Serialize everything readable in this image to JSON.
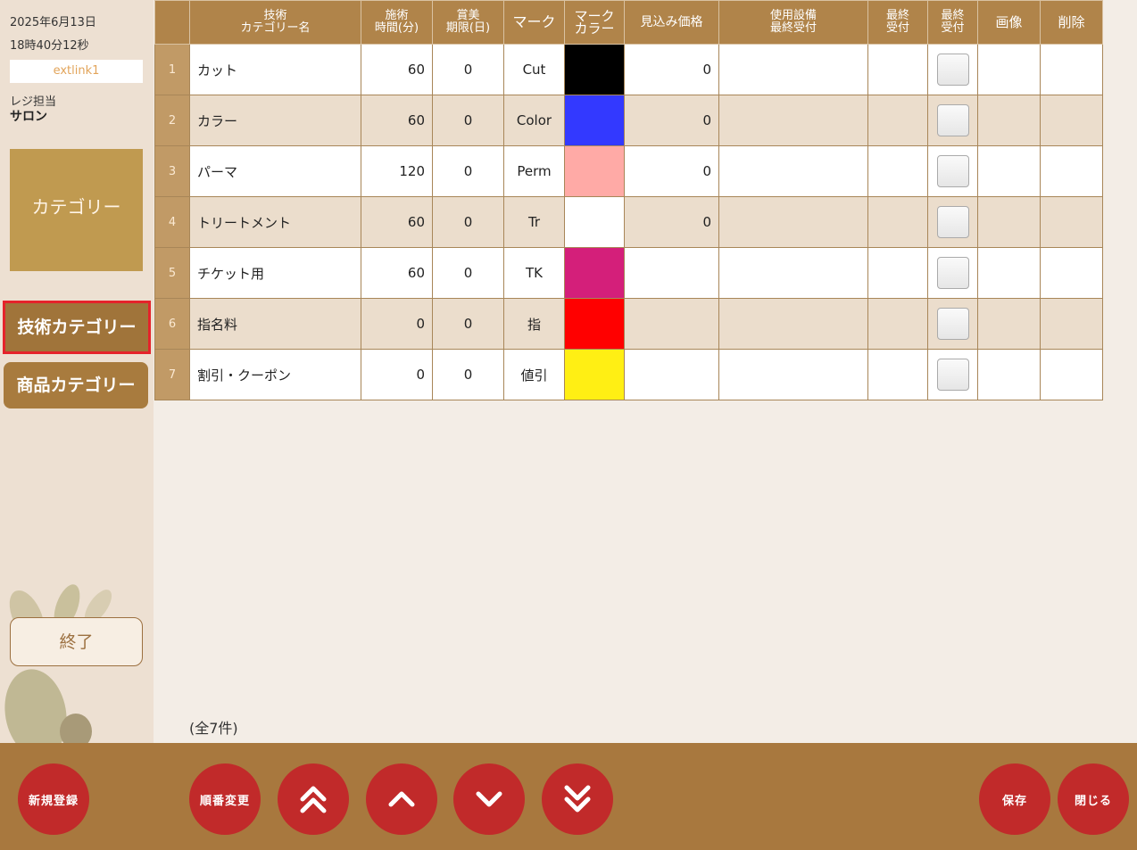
{
  "sidebar": {
    "date": "2025年6月13日",
    "time": "18時40分12秒",
    "link": "extlink1",
    "register_label": "レジ担当",
    "salon": "サロン",
    "category_main": "カテゴリー",
    "tech_category": "技術カテゴリー",
    "product_category": "商品カテゴリー",
    "exit": "終了"
  },
  "table": {
    "headers": {
      "name_1": "技術",
      "name_2": "カテゴリー名",
      "time_1": "施術",
      "time_2": "時間(分)",
      "expiry_1": "賞美",
      "expiry_2": "期限(日)",
      "mark": "マーク",
      "markcolor_1": "マーク",
      "markcolor_2": "カラー",
      "price": "見込み価格",
      "equip_1": "使用設備",
      "equip_2": "最終受付",
      "last1_1": "最終",
      "last1_2": "受付",
      "last2_1": "最終",
      "last2_2": "受付",
      "image": "画像",
      "delete": "削除"
    },
    "rows": [
      {
        "no": "1",
        "name": "カット",
        "time": "60",
        "expiry": "0",
        "mark": "Cut",
        "color": "#000000",
        "price": "0"
      },
      {
        "no": "2",
        "name": "カラー",
        "time": "60",
        "expiry": "0",
        "mark": "Color",
        "color": "#3339ff",
        "price": "0"
      },
      {
        "no": "3",
        "name": "パーマ",
        "time": "120",
        "expiry": "0",
        "mark": "Perm",
        "color": "#ffaaa6",
        "price": "0"
      },
      {
        "no": "4",
        "name": "トリートメント",
        "time": "60",
        "expiry": "0",
        "mark": "Tr",
        "color": "#ffffff",
        "price": "0"
      },
      {
        "no": "5",
        "name": "チケット用",
        "time": "60",
        "expiry": "0",
        "mark": "TK",
        "color": "#d41f7a",
        "price": ""
      },
      {
        "no": "6",
        "name": "指名料",
        "time": "0",
        "expiry": "0",
        "mark": "指",
        "color": "#ff0000",
        "price": ""
      },
      {
        "no": "7",
        "name": "割引・クーポン",
        "time": "0",
        "expiry": "0",
        "mark": "値引",
        "color": "#ffef14",
        "price": ""
      }
    ]
  },
  "count": "(全7件)",
  "footer": {
    "new": "新規登録",
    "reorder": "順番変更",
    "save": "保存",
    "close": "閉じる"
  },
  "icons": [
    "double-chevron-up-icon",
    "chevron-up-icon",
    "chevron-down-icon",
    "double-chevron-down-icon"
  ]
}
